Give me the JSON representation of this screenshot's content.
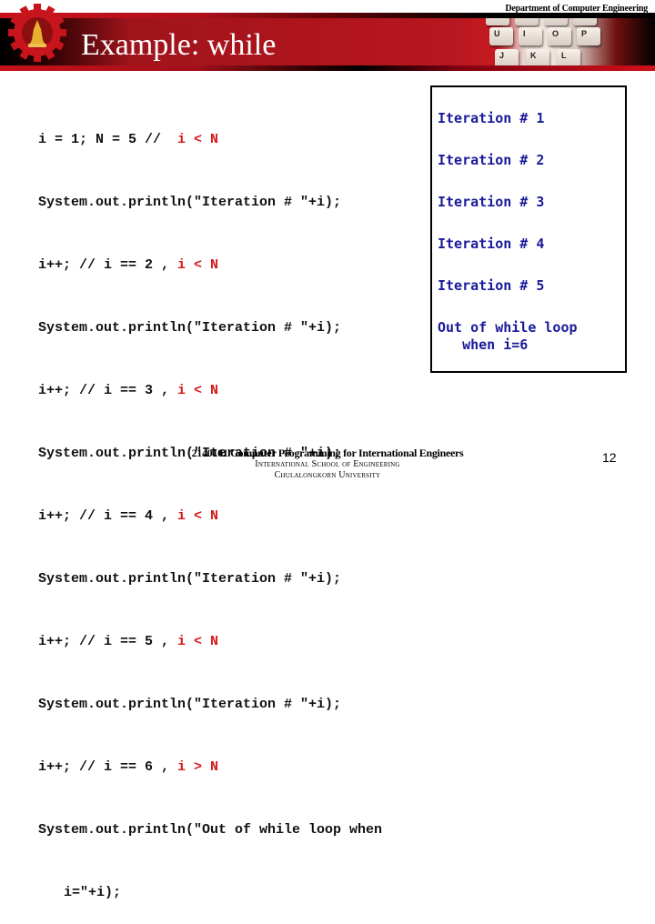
{
  "header": {
    "department": "Department of Computer Engineering",
    "title": "Example: while",
    "logo_icon": "chulalongkorn-gear-emblem-icon",
    "keyboard_keys": [
      "U",
      "I",
      "O",
      "P",
      "J",
      "K",
      "L"
    ],
    "colors": {
      "banner_red": "#b0141c",
      "banner_black": "#000000"
    }
  },
  "code": {
    "lines": [
      {
        "text": "i = 1; N = 5 //  ",
        "cond": "i < N"
      },
      {
        "text": "System.out.println(\"Iteration # \"+i);"
      },
      {
        "text": "i++; // i == 2 , ",
        "cond": "i < N"
      },
      {
        "text": "System.out.println(\"Iteration # \"+i);"
      },
      {
        "text": "i++; // i == 3 , ",
        "cond": "i < N"
      },
      {
        "text": "System.out.println(\"Iteration # \"+i);"
      },
      {
        "text": "i++; // i == 4 , ",
        "cond": "i < N"
      },
      {
        "text": "System.out.println(\"Iteration # \"+i);"
      },
      {
        "text": "i++; // i == 5 , ",
        "cond": "i < N"
      },
      {
        "text": "System.out.println(\"Iteration # \"+i);"
      },
      {
        "text": "i++; // i == 6 , ",
        "cond": "i > N"
      },
      {
        "text": "System.out.println(\"Out of while loop when"
      },
      {
        "text": "i=\"+i);"
      }
    ],
    "colors": {
      "text": "#111111",
      "condition": "#d41a1a"
    }
  },
  "output": {
    "lines": [
      "Iteration # 1",
      "Iteration # 2",
      "Iteration # 3",
      "Iteration # 4",
      "Iteration # 5",
      "Out of while loop",
      "   when i=6"
    ],
    "color": "#1a1a9a"
  },
  "footer": {
    "course": "2140101 Computer Programming for International Engineers",
    "school": "International School of Engineering",
    "university": "Chulalongkorn University",
    "page_number": "12"
  }
}
